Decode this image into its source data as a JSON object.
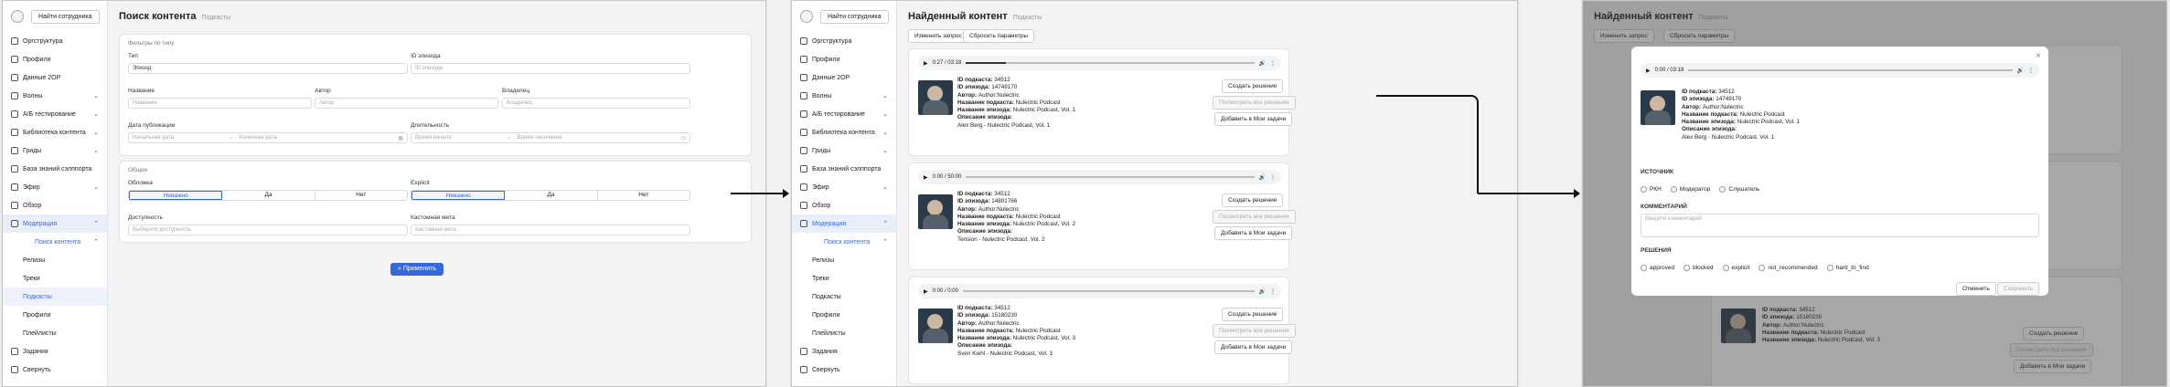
{
  "sidebar": {
    "find_employee": "Найти сотрудника",
    "items": [
      {
        "label": "Оргструктура",
        "chev": ""
      },
      {
        "label": "Профили",
        "chev": ""
      },
      {
        "label": "Данные 2ОР",
        "chev": ""
      },
      {
        "label": "Волны",
        "chev": "⌄"
      },
      {
        "label": "А/Б тестирование",
        "chev": "⌄"
      },
      {
        "label": "Библиотека контента",
        "chev": "⌄"
      },
      {
        "label": "Гриды",
        "chev": "⌄"
      },
      {
        "label": "База знаний сэлппорта",
        "chev": ""
      },
      {
        "label": "Эфир",
        "chev": "⌄"
      },
      {
        "label": "Обзор",
        "chev": ""
      },
      {
        "label": "Модерация",
        "chev": "⌃"
      },
      {
        "label": "Поиск контента",
        "chev": "⌃"
      }
    ],
    "subitems": [
      "Релизы",
      "Треки",
      "Подкасты",
      "Профили",
      "Плейлисты"
    ],
    "bottom": [
      "Задания",
      "Свернуть"
    ]
  },
  "screen1": {
    "title": "Поиск контента",
    "breadcrumb": "Подкасты",
    "filters_title": "Фильтры по типу",
    "type_label": "Тип",
    "type_value": "Эпизод",
    "episode_id_label": "ID эпизода",
    "episode_id_ph": "ID эпизода",
    "name_label": "Название",
    "name_ph": "Название",
    "author_label": "Автор",
    "author_ph": "Автор",
    "owner_label": "Владелец",
    "owner_ph": "Владелец",
    "pubdate_label": "Дата публикации",
    "start_date_ph": "Начальная дата",
    "end_date_ph": "Конечная дата",
    "duration_label": "Длительность",
    "duration_start_ph": "Время начала",
    "duration_end_ph": "Время окончания",
    "general_title": "Общее",
    "cover_label": "Обложка",
    "explicit_label": "Explicit",
    "seg_options": [
      "Неважно",
      "Да",
      "Нет"
    ],
    "availability_label": "Доступность",
    "availability_ph": "Выберите доступность",
    "custom_meta_label": "Кастомная мета",
    "custom_meta_ph": "Кастомная мета",
    "apply": "Применить"
  },
  "screen2": {
    "title": "Найденный контент",
    "breadcrumb": "Подкасты",
    "change_query": "Изменить запрос",
    "reset_params": "Сбросить параметры",
    "create_decision": "Создать решение",
    "view_decisions": "Посмотреть все решения",
    "add_tasks": "Добавить в Мои задачи",
    "results": [
      {
        "time": "0:27 / 03:18",
        "progress": 0.14,
        "podcast_id": "34512",
        "episode_id": "14749170",
        "author": "Author:Nulectric",
        "podcast_name": "Nulectric Podcast",
        "episode_name": "Nulectric Podcast, Vol. 1",
        "description": "Alex Berg - Nulectric Podcast, Vol. 1"
      },
      {
        "time": "0:00 / 50:00",
        "progress": 0,
        "podcast_id": "34512",
        "episode_id": "14801766",
        "author": "Author:Nulectric",
        "podcast_name": "Nulectric Podcast",
        "episode_name": "Nulectric Podcast, Vol. 2",
        "description": "Tension - Nulectric Podcast, Vol. 2"
      },
      {
        "time": "0:00 / 0:00",
        "progress": 0,
        "podcast_id": "34512",
        "episode_id": "15180230",
        "author": "Author:Nulectric",
        "podcast_name": "Nulectric Podcast",
        "episode_name": "Nulectric Podcast, Vol. 3",
        "description": "Sven Kiehl - Nulectric Podcast, Vol. 3"
      }
    ],
    "labels": {
      "podcast_id": "ID подкаста:",
      "episode_id": "ID эпизода:",
      "author": "Автор:",
      "podcast_name": "Название подкаста:",
      "episode_name": "Название эпизода:",
      "description": "Описание эпизода:"
    }
  },
  "screen3": {
    "modal": {
      "time": "0:00 / 03:18",
      "source_title": "ИСТОЧНИК",
      "sources": [
        "РКН",
        "Модератор",
        "Слушатель"
      ],
      "comment_title": "КОММЕНТАРИЙ",
      "comment_ph": "Введите комментарий",
      "decisions_title": "РЕШЕНИЯ",
      "decisions": [
        "approved",
        "blocked",
        "explicit",
        "not_recommended",
        "hard_to_find"
      ],
      "cancel": "Отменить",
      "submit": "Сохранить",
      "close": "×"
    }
  }
}
